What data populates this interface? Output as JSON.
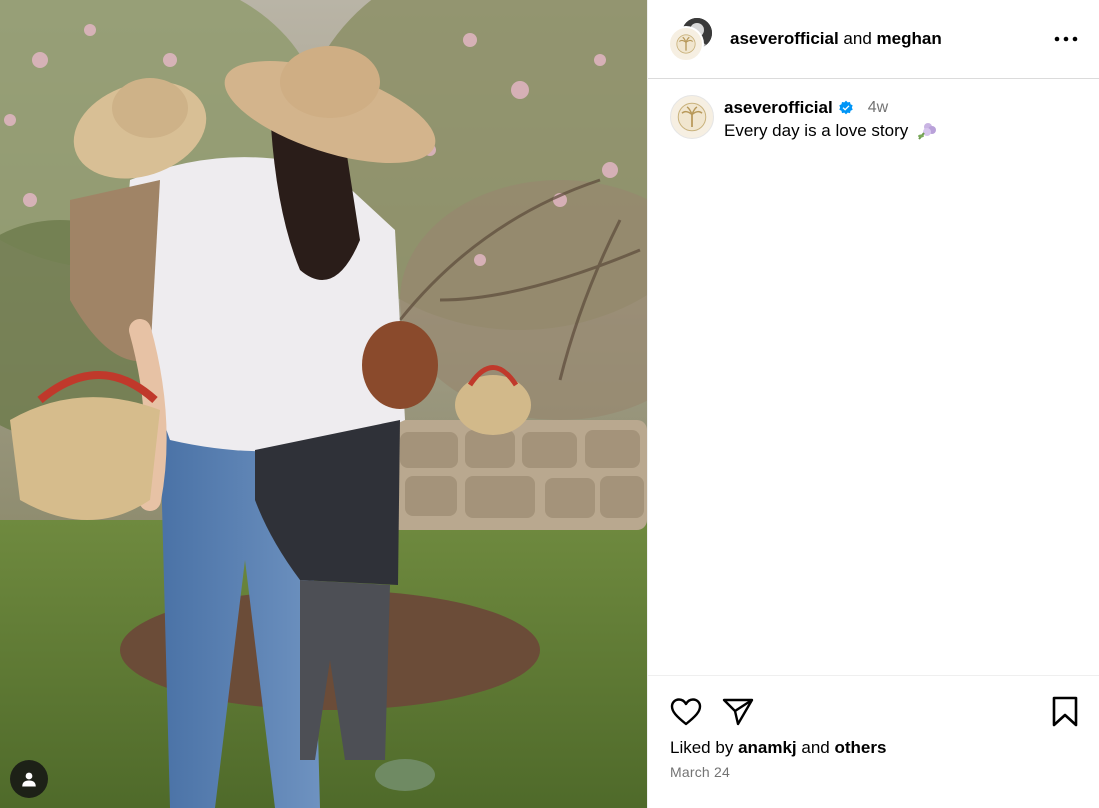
{
  "header": {
    "author": "aseverofficial",
    "conjunction": "and",
    "coauthor": "meghan",
    "more_icon": "more-horizontal-icon"
  },
  "caption": {
    "username": "aseverofficial",
    "verified_icon": "verified-badge-icon",
    "time_ago": "4w",
    "text": "Every day is a love story",
    "emoji_icon": "flower-emoji-icon"
  },
  "actions": {
    "like_icon": "heart-icon",
    "share_icon": "paper-plane-icon",
    "save_icon": "bookmark-icon"
  },
  "likes": {
    "prefix": "Liked by",
    "user": "anamkj",
    "conjunction": "and",
    "others": "others"
  },
  "post_date": "March 24",
  "media": {
    "tag_icon": "user-tag-icon"
  },
  "colors": {
    "verified_blue": "#0095f6",
    "secondary_text": "#737373",
    "divider": "#dbdbdb"
  }
}
